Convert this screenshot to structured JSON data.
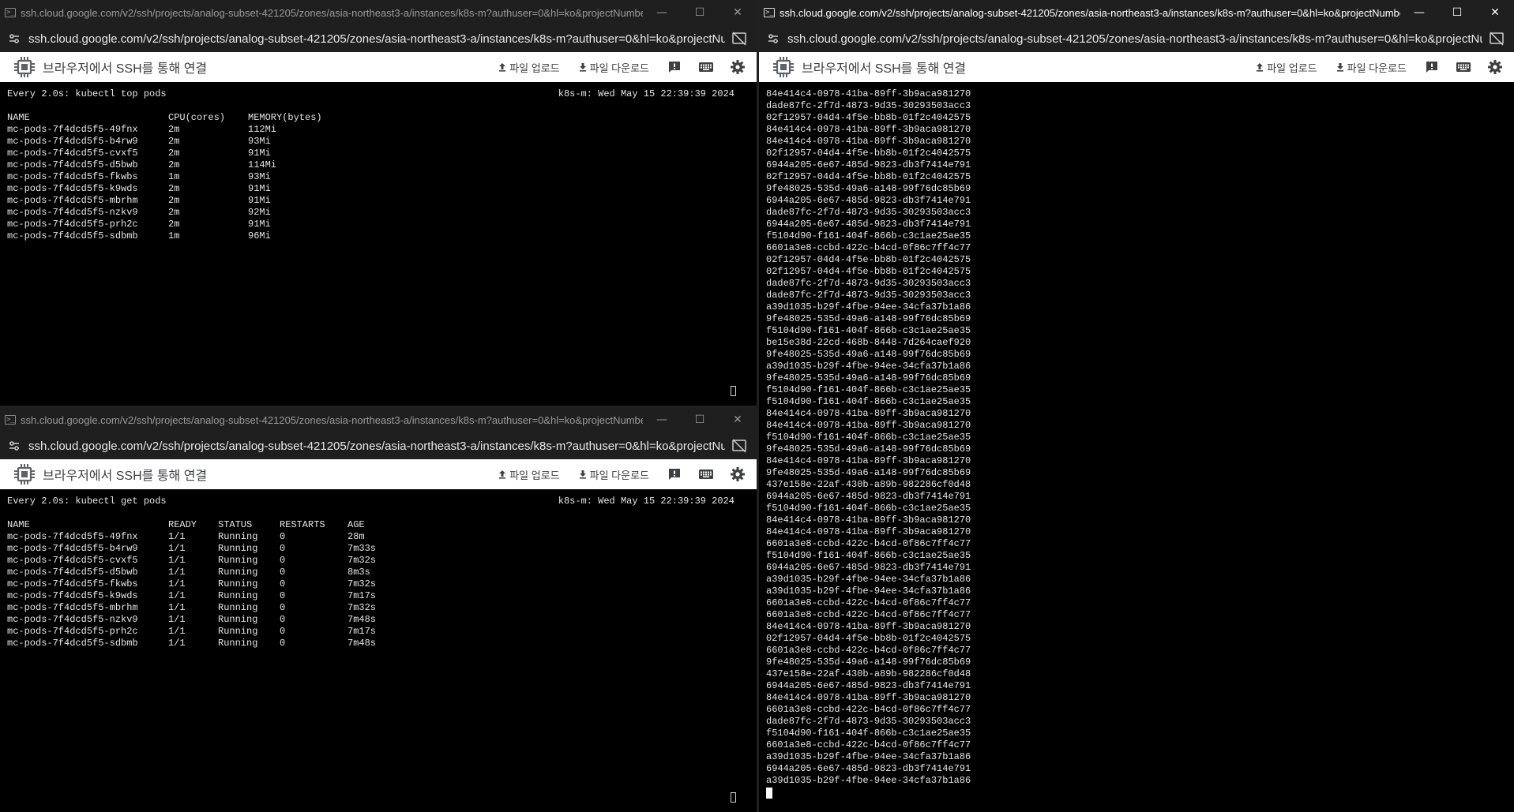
{
  "windows": {
    "url_title": "ssh.cloud.google.com/v2/ssh/projects/analog-subset-421205/zones/asia-northeast3-a/instances/k8s-m?authuser=0&hl=ko&projectNumber=12...",
    "url_bar": "ssh.cloud.google.com/v2/ssh/projects/analog-subset-421205/zones/asia-northeast3-a/instances/k8s-m?authuser=0&hl=ko&projectNu...",
    "controls": {
      "minimize": "—",
      "maximize": "☐",
      "close": "✕"
    },
    "toolbar": {
      "title": "브라우저에서 SSH를 통해 연결",
      "upload": "파일 업로드",
      "download": "파일 다운로드"
    },
    "icons": [
      "terminal-app-icon",
      "site-settings-icon",
      "cast-off-icon",
      "compute-chip-icon",
      "upload-icon",
      "download-icon",
      "feedback-icon",
      "keyboard-icon",
      "settings-gear-icon"
    ]
  },
  "top_pods": {
    "command": "Every 2.0s: kubectl top pods",
    "host_time": "k8s-m: Wed May 15 22:39:39 2024",
    "headers": [
      "NAME",
      "CPU(cores)",
      "MEMORY(bytes)"
    ],
    "rows": [
      [
        "mc-pods-7f4dcd5f5-49fnx",
        "2m",
        "112Mi"
      ],
      [
        "mc-pods-7f4dcd5f5-b4rw9",
        "2m",
        "93Mi"
      ],
      [
        "mc-pods-7f4dcd5f5-cvxf5",
        "2m",
        "91Mi"
      ],
      [
        "mc-pods-7f4dcd5f5-d5bwb",
        "2m",
        "114Mi"
      ],
      [
        "mc-pods-7f4dcd5f5-fkwbs",
        "1m",
        "93Mi"
      ],
      [
        "mc-pods-7f4dcd5f5-k9wds",
        "2m",
        "91Mi"
      ],
      [
        "mc-pods-7f4dcd5f5-mbrhm",
        "2m",
        "91Mi"
      ],
      [
        "mc-pods-7f4dcd5f5-nzkv9",
        "2m",
        "92Mi"
      ],
      [
        "mc-pods-7f4dcd5f5-prh2c",
        "2m",
        "91Mi"
      ],
      [
        "mc-pods-7f4dcd5f5-sdbmb",
        "1m",
        "96Mi"
      ]
    ]
  },
  "get_pods": {
    "command": "Every 2.0s: kubectl get pods",
    "host_time": "k8s-m: Wed May 15 22:39:39 2024",
    "headers": [
      "NAME",
      "READY",
      "STATUS",
      "RESTARTS",
      "AGE"
    ],
    "rows": [
      [
        "mc-pods-7f4dcd5f5-49fnx",
        "1/1",
        "Running",
        "0",
        "28m"
      ],
      [
        "mc-pods-7f4dcd5f5-b4rw9",
        "1/1",
        "Running",
        "0",
        "7m33s"
      ],
      [
        "mc-pods-7f4dcd5f5-cvxf5",
        "1/1",
        "Running",
        "0",
        "7m32s"
      ],
      [
        "mc-pods-7f4dcd5f5-d5bwb",
        "1/1",
        "Running",
        "0",
        "8m3s"
      ],
      [
        "mc-pods-7f4dcd5f5-fkwbs",
        "1/1",
        "Running",
        "0",
        "7m32s"
      ],
      [
        "mc-pods-7f4dcd5f5-k9wds",
        "1/1",
        "Running",
        "0",
        "7m17s"
      ],
      [
        "mc-pods-7f4dcd5f5-mbrhm",
        "1/1",
        "Running",
        "0",
        "7m32s"
      ],
      [
        "mc-pods-7f4dcd5f5-nzkv9",
        "1/1",
        "Running",
        "0",
        "7m48s"
      ],
      [
        "mc-pods-7f4dcd5f5-prh2c",
        "1/1",
        "Running",
        "0",
        "7m17s"
      ],
      [
        "mc-pods-7f4dcd5f5-sdbmb",
        "1/1",
        "Running",
        "0",
        "7m48s"
      ]
    ]
  },
  "uuid_output": [
    "84e414c4-0978-41ba-89ff-3b9aca981270",
    "dade87fc-2f7d-4873-9d35-30293503acc3",
    "02f12957-04d4-4f5e-bb8b-01f2c4042575",
    "84e414c4-0978-41ba-89ff-3b9aca981270",
    "84e414c4-0978-41ba-89ff-3b9aca981270",
    "02f12957-04d4-4f5e-bb8b-01f2c4042575",
    "6944a205-6e67-485d-9823-db3f7414e791",
    "02f12957-04d4-4f5e-bb8b-01f2c4042575",
    "9fe48025-535d-49a6-a148-99f76dc85b69",
    "6944a205-6e67-485d-9823-db3f7414e791",
    "dade87fc-2f7d-4873-9d35-30293503acc3",
    "6944a205-6e67-485d-9823-db3f7414e791",
    "f5104d90-f161-404f-866b-c3c1ae25ae35",
    "6601a3e8-ccbd-422c-b4cd-0f86c7ff4c77",
    "02f12957-04d4-4f5e-bb8b-01f2c4042575",
    "02f12957-04d4-4f5e-bb8b-01f2c4042575",
    "dade87fc-2f7d-4873-9d35-30293503acc3",
    "dade87fc-2f7d-4873-9d35-30293503acc3",
    "a39d1035-b29f-4fbe-94ee-34cfa37b1a86",
    "9fe48025-535d-49a6-a148-99f76dc85b69",
    "f5104d90-f161-404f-866b-c3c1ae25ae35",
    "be15e38d-22cd-468b-8448-7d264caef920",
    "9fe48025-535d-49a6-a148-99f76dc85b69",
    "a39d1035-b29f-4fbe-94ee-34cfa37b1a86",
    "9fe48025-535d-49a6-a148-99f76dc85b69",
    "f5104d90-f161-404f-866b-c3c1ae25ae35",
    "f5104d90-f161-404f-866b-c3c1ae25ae35",
    "84e414c4-0978-41ba-89ff-3b9aca981270",
    "84e414c4-0978-41ba-89ff-3b9aca981270",
    "f5104d90-f161-404f-866b-c3c1ae25ae35",
    "9fe48025-535d-49a6-a148-99f76dc85b69",
    "84e414c4-0978-41ba-89ff-3b9aca981270",
    "9fe48025-535d-49a6-a148-99f76dc85b69",
    "437e158e-22af-430b-a89b-982286cf0d48",
    "6944a205-6e67-485d-9823-db3f7414e791",
    "f5104d90-f161-404f-866b-c3c1ae25ae35",
    "84e414c4-0978-41ba-89ff-3b9aca981270",
    "84e414c4-0978-41ba-89ff-3b9aca981270",
    "6601a3e8-ccbd-422c-b4cd-0f86c7ff4c77",
    "f5104d90-f161-404f-866b-c3c1ae25ae35",
    "6944a205-6e67-485d-9823-db3f7414e791",
    "a39d1035-b29f-4fbe-94ee-34cfa37b1a86",
    "a39d1035-b29f-4fbe-94ee-34cfa37b1a86",
    "6601a3e8-ccbd-422c-b4cd-0f86c7ff4c77",
    "6601a3e8-ccbd-422c-b4cd-0f86c7ff4c77",
    "84e414c4-0978-41ba-89ff-3b9aca981270",
    "02f12957-04d4-4f5e-bb8b-01f2c4042575",
    "6601a3e8-ccbd-422c-b4cd-0f86c7ff4c77",
    "9fe48025-535d-49a6-a148-99f76dc85b69",
    "437e158e-22af-430b-a89b-982286cf0d48",
    "6944a205-6e67-485d-9823-db3f7414e791",
    "84e414c4-0978-41ba-89ff-3b9aca981270",
    "6601a3e8-ccbd-422c-b4cd-0f86c7ff4c77",
    "dade87fc-2f7d-4873-9d35-30293503acc3",
    "f5104d90-f161-404f-866b-c3c1ae25ae35",
    "6601a3e8-ccbd-422c-b4cd-0f86c7ff4c77",
    "a39d1035-b29f-4fbe-94ee-34cfa37b1a86",
    "6944a205-6e67-485d-9823-db3f7414e791",
    "a39d1035-b29f-4fbe-94ee-34cfa37b1a86"
  ]
}
